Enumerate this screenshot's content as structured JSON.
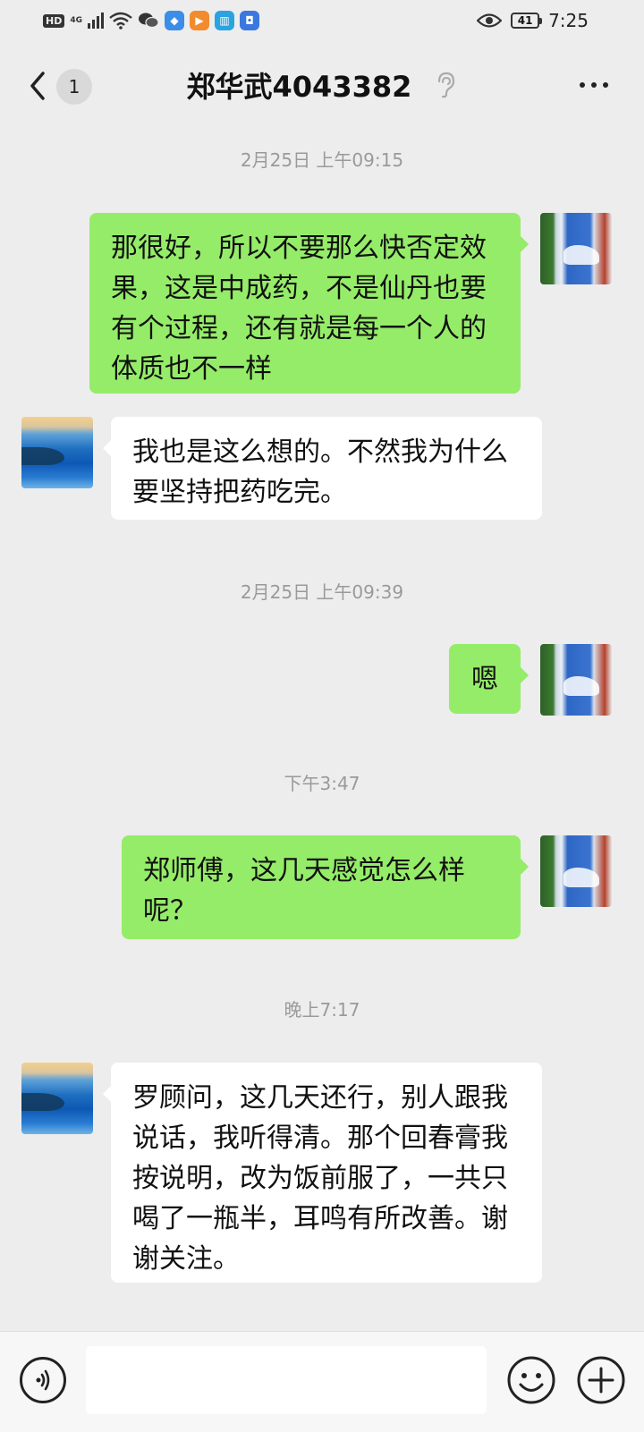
{
  "status_bar": {
    "network_label": "HD",
    "network_type": "4G",
    "battery": "41",
    "time": "7:25"
  },
  "header": {
    "unread_count": "1",
    "title": "郑华武4043382"
  },
  "messages": [
    {
      "type": "time",
      "text": "2月25日 上午09:15"
    },
    {
      "type": "out",
      "text": "那很好，所以不要那么快否定效果，这是中成药，不是仙丹也要有个过程，还有就是每一个人的体质也不一样"
    },
    {
      "type": "in",
      "text": "我也是这么想的。不然我为什么要坚持把药吃完。"
    },
    {
      "type": "time",
      "text": "2月25日 上午09:39"
    },
    {
      "type": "out",
      "text": "嗯"
    },
    {
      "type": "time",
      "text": "下午3:47"
    },
    {
      "type": "out",
      "text": "郑师傅，这几天感觉怎么样呢？"
    },
    {
      "type": "time",
      "text": "晚上7:17"
    },
    {
      "type": "in",
      "text": "罗顾问，这几天还行，别人跟我说话，我听得清。那个回春膏我按说明，改为饭前服了，一共只喝了一瓶半，耳鸣有所改善。谢谢关注。"
    }
  ],
  "input": {
    "value": "",
    "placeholder": ""
  },
  "colors": {
    "background": "#ededed",
    "outgoing_bubble": "#95ec69",
    "incoming_bubble": "#ffffff",
    "timestamp_text": "#9a9a9a"
  },
  "icons": [
    "back-icon",
    "ear-icon",
    "more-icon",
    "voice-icon",
    "emoji-icon",
    "plus-icon",
    "wifi-icon",
    "eye-icon"
  ]
}
